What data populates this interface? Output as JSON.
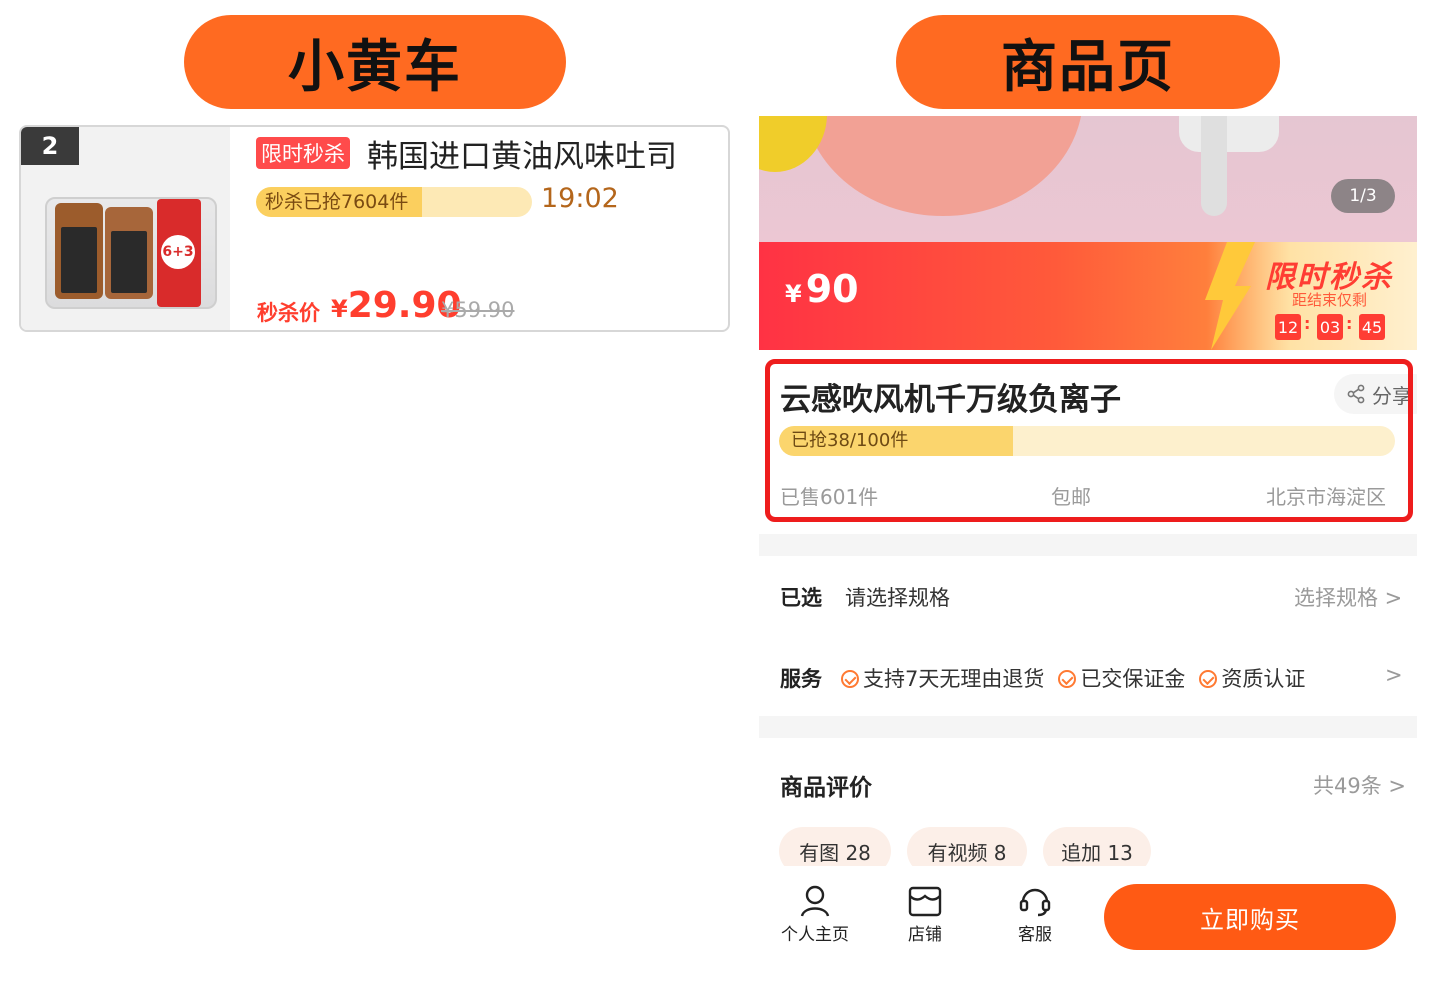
{
  "left_header": "小黄车",
  "right_header": "商品页",
  "cart": {
    "rank": "2",
    "flash_tag": "限时秒杀",
    "title": "韩国进口黄油风味吐司",
    "grab_text": "秒杀已抢7604件",
    "grab_progress": 0.6,
    "countdown": "19:02",
    "price_label": "秒杀价",
    "price_currency": "¥",
    "price": "29.90",
    "original_price": "¥59.90",
    "image_badge": "6+3"
  },
  "product": {
    "pager": "1/3",
    "price_currency": "¥",
    "price": "90",
    "flash_title": "限时秒杀",
    "flash_sub": "距结束仅剩",
    "timer": {
      "h": "12",
      "m": "03",
      "s": "45",
      "sep": ":"
    },
    "title": "云感吹风机千万级负离子",
    "share_label": "分享",
    "sold_text": "已抢38/100件",
    "sold_progress": 0.38,
    "sold_count": "已售601件",
    "shipping": "包邮",
    "location": "北京市海淀区",
    "spec_label": "已选",
    "spec_value": "请选择规格",
    "spec_action": "选择规格 >",
    "service_label": "服务",
    "services": [
      "支持7天无理由退货",
      "已交保证金",
      "资质认证"
    ],
    "service_arrow": ">",
    "review_title": "商品评价",
    "review_count": "共49条 >",
    "review_chips": [
      "有图 28",
      "有视频 8",
      "追加 13"
    ],
    "nav": {
      "home": "个人主页",
      "shop": "店铺",
      "service": "客服"
    },
    "buy_label": "立即购买"
  },
  "colors": {
    "accent": "#ff6a21",
    "flash_red": "#ff3d33",
    "highlight_border": "#ee1d1d"
  }
}
